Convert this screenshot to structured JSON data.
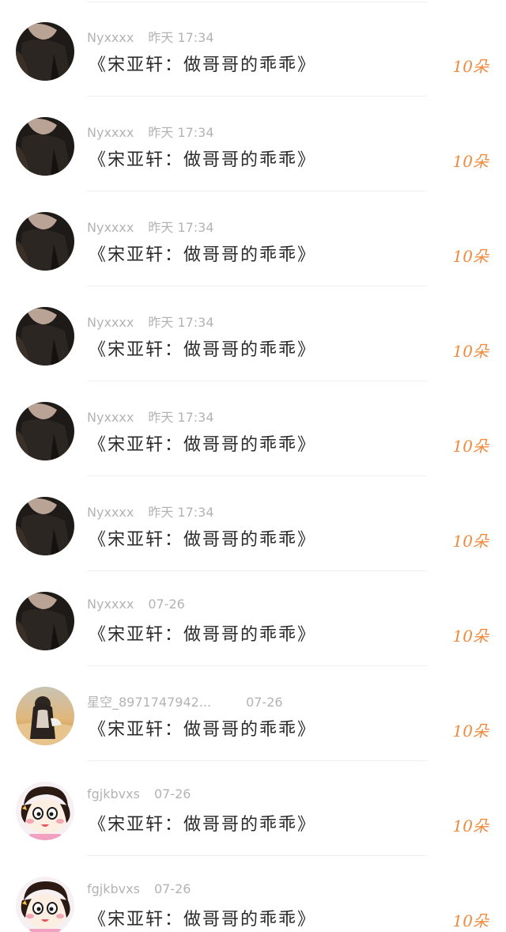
{
  "gift_list": [
    {
      "user": "Nyxxxx",
      "time": "昨天 17:34",
      "message": "《宋亚轩：做哥哥的乖乖》",
      "count": "10朵",
      "avatar": "dark-photo-avatar"
    },
    {
      "user": "Nyxxxx",
      "time": "昨天 17:34",
      "message": "《宋亚轩：做哥哥的乖乖》",
      "count": "10朵",
      "avatar": "dark-photo-avatar"
    },
    {
      "user": "Nyxxxx",
      "time": "昨天 17:34",
      "message": "《宋亚轩：做哥哥的乖乖》",
      "count": "10朵",
      "avatar": "dark-photo-avatar"
    },
    {
      "user": "Nyxxxx",
      "time": "昨天 17:34",
      "message": "《宋亚轩：做哥哥的乖乖》",
      "count": "10朵",
      "avatar": "dark-photo-avatar"
    },
    {
      "user": "Nyxxxx",
      "time": "昨天 17:34",
      "message": "《宋亚轩：做哥哥的乖乖》",
      "count": "10朵",
      "avatar": "dark-photo-avatar"
    },
    {
      "user": "Nyxxxx",
      "time": "昨天 17:34",
      "message": "《宋亚轩：做哥哥的乖乖》",
      "count": "10朵",
      "avatar": "dark-photo-avatar"
    },
    {
      "user": "Nyxxxx",
      "time": "07-26",
      "message": "《宋亚轩：做哥哥的乖乖》",
      "count": "10朵",
      "avatar": "dark-photo-avatar"
    },
    {
      "user": "星空_8971747942...",
      "time": "07-26",
      "message": "《宋亚轩：做哥哥的乖乖》",
      "count": "10朵",
      "avatar": "sunset-girl-avatar"
    },
    {
      "user": "fgjkbvxs",
      "time": "07-26",
      "message": "《宋亚轩：做哥哥的乖乖》",
      "count": "10朵",
      "avatar": "cartoon-girl-avatar"
    },
    {
      "user": "fgjkbvxs",
      "time": "07-26",
      "message": "《宋亚轩：做哥哥的乖乖》",
      "count": "10朵",
      "avatar": "cartoon-girl-avatar"
    }
  ],
  "colors": {
    "count": "#f08a3e",
    "meta": "#b3b3b3",
    "message": "#2a2a2a",
    "divider": "#efefef"
  }
}
